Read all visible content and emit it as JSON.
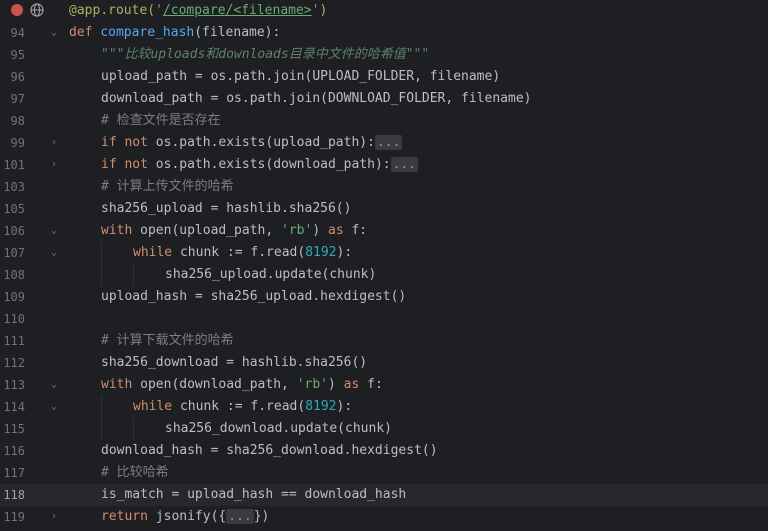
{
  "editor": {
    "lines": [
      {
        "num": "",
        "fold": "",
        "tokens": [
          {
            "cls": "dec",
            "t": "@app.route("
          },
          {
            "cls": "str",
            "t": "'"
          },
          {
            "cls": "link",
            "t": "/compare/<filename>"
          },
          {
            "cls": "str",
            "t": "'"
          },
          {
            "cls": "dec",
            "t": ")"
          }
        ]
      },
      {
        "num": "94",
        "fold": "⌄",
        "tokens": [
          {
            "cls": "kw",
            "t": "def "
          },
          {
            "cls": "fn",
            "t": "compare_hash"
          },
          {
            "cls": "",
            "t": "(filename):"
          }
        ]
      },
      {
        "num": "95",
        "fold": "",
        "indent": 1,
        "tokens": [
          {
            "cls": "doc",
            "t": "\"\"\"比较uploads和downloads目录中文件的哈希值\"\"\""
          }
        ]
      },
      {
        "num": "96",
        "fold": "",
        "indent": 1,
        "tokens": [
          {
            "cls": "",
            "t": "upload_path = os.path.join(UPLOAD_FOLDER, filename)"
          }
        ]
      },
      {
        "num": "97",
        "fold": "",
        "indent": 1,
        "tokens": [
          {
            "cls": "",
            "t": "download_path = os.path.join(DOWNLOAD_FOLDER, filename)"
          }
        ]
      },
      {
        "num": "98",
        "fold": "",
        "indent": 1,
        "tokens": [
          {
            "cls": "cmt",
            "t": "# 检查文件是否存在"
          }
        ]
      },
      {
        "num": "99",
        "fold": "›",
        "indent": 1,
        "tokens": [
          {
            "cls": "kw",
            "t": "if not "
          },
          {
            "cls": "",
            "t": "os.path.exists(upload_path):"
          },
          {
            "cls": "folded",
            "t": "..."
          }
        ]
      },
      {
        "num": "101",
        "fold": "›",
        "indent": 1,
        "tokens": [
          {
            "cls": "kw",
            "t": "if not "
          },
          {
            "cls": "",
            "t": "os.path.exists(download_path):"
          },
          {
            "cls": "folded",
            "t": "..."
          }
        ]
      },
      {
        "num": "103",
        "fold": "",
        "indent": 1,
        "tokens": [
          {
            "cls": "cmt",
            "t": "# 计算上传文件的哈希"
          }
        ]
      },
      {
        "num": "105",
        "fold": "",
        "indent": 1,
        "tokens": [
          {
            "cls": "",
            "t": "sha256_upload = hashlib.sha256()"
          }
        ]
      },
      {
        "num": "106",
        "fold": "⌄",
        "indent": 1,
        "tokens": [
          {
            "cls": "kw",
            "t": "with "
          },
          {
            "cls": "",
            "t": "open(upload_path, "
          },
          {
            "cls": "str",
            "t": "'rb'"
          },
          {
            "cls": "",
            "t": ") "
          },
          {
            "cls": "kw",
            "t": "as "
          },
          {
            "cls": "",
            "t": "f:"
          }
        ]
      },
      {
        "num": "107",
        "fold": "⌄",
        "indent": 2,
        "tokens": [
          {
            "cls": "kw",
            "t": "while "
          },
          {
            "cls": "",
            "t": "chunk := f.read("
          },
          {
            "cls": "num",
            "t": "8192"
          },
          {
            "cls": "",
            "t": "):"
          }
        ]
      },
      {
        "num": "108",
        "fold": "",
        "indent": 3,
        "tokens": [
          {
            "cls": "",
            "t": "sha256_upload.update(chunk)"
          }
        ]
      },
      {
        "num": "109",
        "fold": "",
        "indent": 1,
        "tokens": [
          {
            "cls": "",
            "t": "upload_hash = sha256_upload.hexdigest()"
          }
        ]
      },
      {
        "num": "110",
        "fold": "",
        "indent": 0,
        "tokens": []
      },
      {
        "num": "111",
        "fold": "",
        "indent": 1,
        "tokens": [
          {
            "cls": "cmt",
            "t": "# 计算下载文件的哈希"
          }
        ]
      },
      {
        "num": "112",
        "fold": "",
        "indent": 1,
        "tokens": [
          {
            "cls": "",
            "t": "sha256_download = hashlib.sha256()"
          }
        ]
      },
      {
        "num": "113",
        "fold": "⌄",
        "indent": 1,
        "tokens": [
          {
            "cls": "kw",
            "t": "with "
          },
          {
            "cls": "",
            "t": "open(download_path, "
          },
          {
            "cls": "str",
            "t": "'rb'"
          },
          {
            "cls": "",
            "t": ") "
          },
          {
            "cls": "kw",
            "t": "as "
          },
          {
            "cls": "",
            "t": "f:"
          }
        ]
      },
      {
        "num": "114",
        "fold": "⌄",
        "indent": 2,
        "tokens": [
          {
            "cls": "kw",
            "t": "while "
          },
          {
            "cls": "",
            "t": "chunk := f.read("
          },
          {
            "cls": "num",
            "t": "8192"
          },
          {
            "cls": "",
            "t": "):"
          }
        ]
      },
      {
        "num": "115",
        "fold": "",
        "indent": 3,
        "tokens": [
          {
            "cls": "",
            "t": "sha256_download.update(chunk)"
          }
        ]
      },
      {
        "num": "116",
        "fold": "",
        "indent": 1,
        "tokens": [
          {
            "cls": "",
            "t": "download_hash = sha256_download.hexdigest()"
          }
        ]
      },
      {
        "num": "117",
        "fold": "",
        "indent": 1,
        "tokens": [
          {
            "cls": "cmt",
            "t": "# 比较哈希"
          }
        ]
      },
      {
        "num": "118",
        "fold": "",
        "indent": 1,
        "current": true,
        "tokens": [
          {
            "cls": "",
            "t": "is_match = upload_hash == download_hash"
          }
        ]
      },
      {
        "num": "119",
        "fold": "›",
        "indent": 1,
        "tokens": [
          {
            "cls": "kw",
            "t": "return "
          },
          {
            "cls": "",
            "t": "jsonify({"
          },
          {
            "cls": "folded",
            "t": "..."
          },
          {
            "cls": "",
            "t": "})"
          }
        ]
      }
    ]
  },
  "icons": {
    "breakpoint": "breakpoint-icon",
    "globe": "globe-icon"
  },
  "colors": {
    "background": "#1e1f22",
    "keyword": "#cf8e6d",
    "function": "#56a8f5",
    "string": "#6aab73",
    "number": "#2aacb8",
    "comment": "#7a7e85",
    "docstring": "#5f826b",
    "decorator": "#b3ae60"
  }
}
